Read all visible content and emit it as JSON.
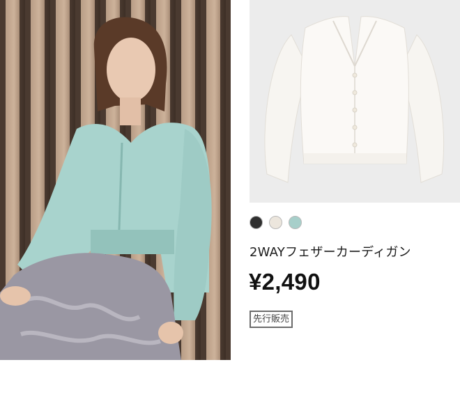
{
  "product": {
    "name": "2WAYフェザーカーディガン",
    "price": "¥2,490",
    "badge": "先行販売",
    "colors": [
      {
        "name": "black",
        "hex": "#2f2f2f"
      },
      {
        "name": "off-white",
        "hex": "#ece6dd"
      },
      {
        "name": "mint",
        "hex": "#a7cfca"
      }
    ]
  }
}
